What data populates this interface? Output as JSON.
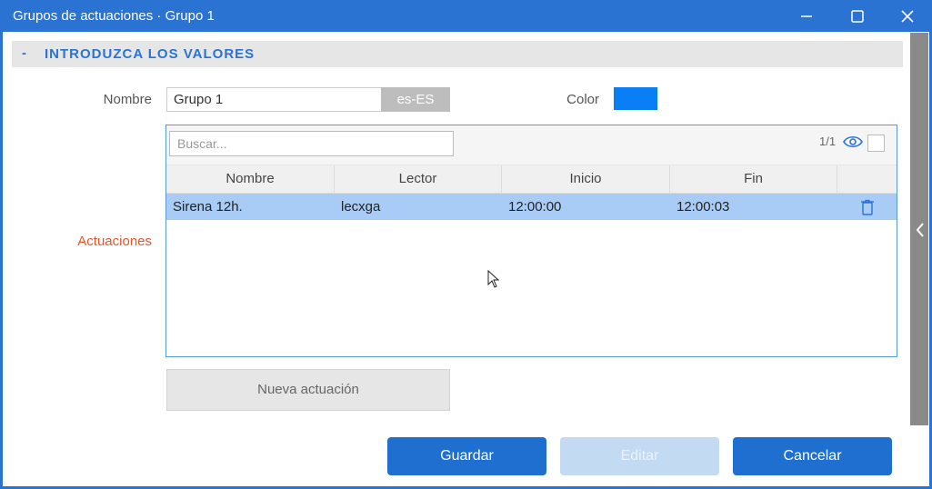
{
  "window": {
    "title": "Grupos de actuaciones · Grupo 1",
    "accent_color": "#2b73d3"
  },
  "section": {
    "toggle": "-",
    "title": "INTRODUZCA LOS VALORES"
  },
  "form": {
    "name_label": "Nombre",
    "name_value": "Grupo 1",
    "language": "es-ES",
    "color_label": "Color",
    "color_value": "#0a7ef5",
    "actions_label": "Actuaciones"
  },
  "grid": {
    "search_placeholder": "Buscar...",
    "pager": "1/1",
    "columns": [
      "Nombre",
      "Lector",
      "Inicio",
      "Fin"
    ],
    "rows": [
      [
        "Sirena 12h.",
        "lecxga",
        "12:00:00",
        "12:00:03"
      ]
    ]
  },
  "buttons": {
    "new_action": "Nueva actuación",
    "save": "Guardar",
    "edit": "Editar",
    "cancel": "Cancelar"
  },
  "icons": {
    "minimize": "minimize-icon",
    "maximize": "maximize-icon",
    "close": "close-icon",
    "eye": "eye-icon",
    "trash": "trash-icon",
    "collapse": "chevron-left-icon"
  }
}
